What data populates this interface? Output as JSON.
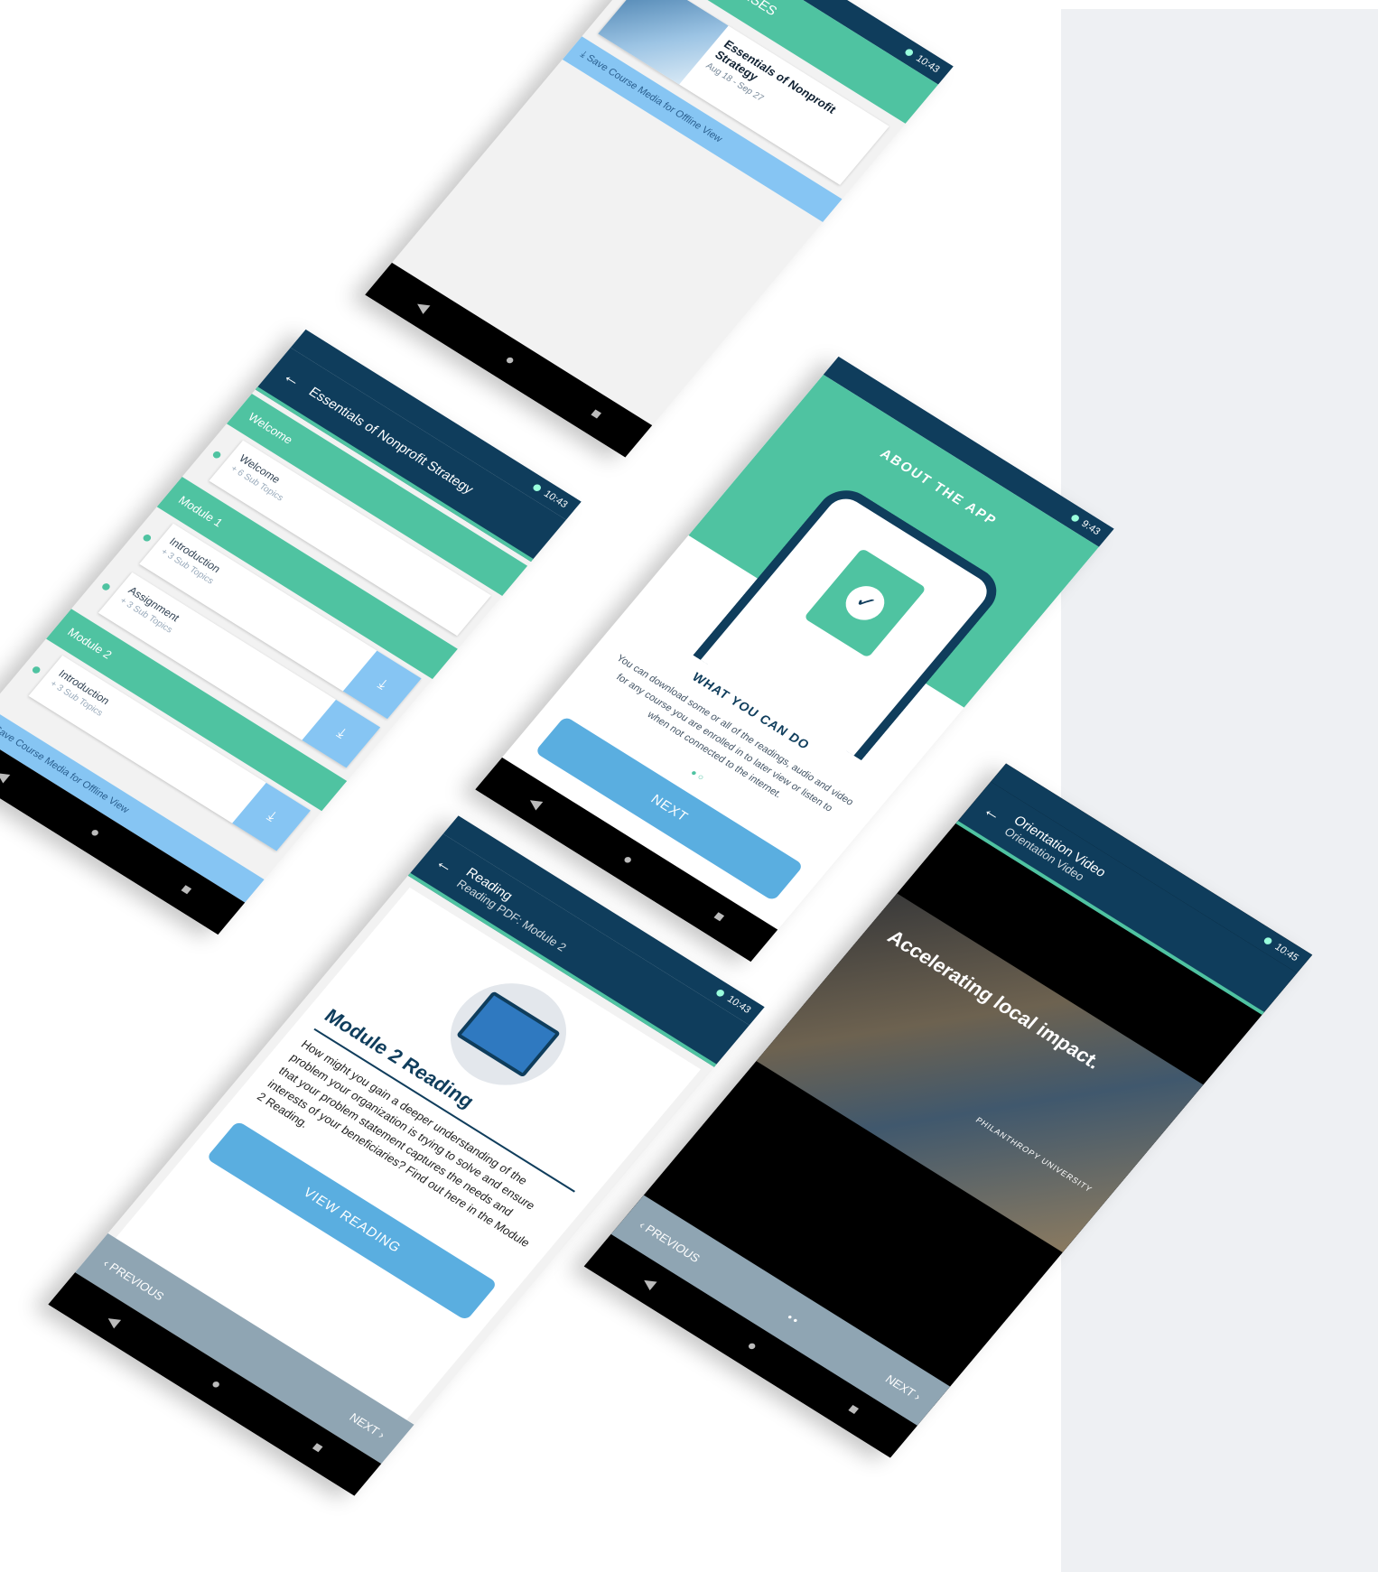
{
  "status": {
    "time_a": "10:43",
    "time_b": "9:43",
    "time_c": "10:45"
  },
  "my_courses": {
    "app_title": "MY COURSES",
    "course_title": "Essentials of Nonprofit Strategy",
    "course_dates": "Aug 18 - Sep 27",
    "save_label": "Save Course Media for Offline View"
  },
  "course_outline": {
    "app_title": "Essentials of Nonprofit Strategy",
    "sections": [
      {
        "name": "Welcome",
        "topics": [
          {
            "name": "Welcome",
            "sub": "+ 6 Sub Topics"
          }
        ]
      },
      {
        "name": "Module 1",
        "topics": [
          {
            "name": "Introduction",
            "sub": "+ 3 Sub Topics"
          },
          {
            "name": "Assignment",
            "sub": "+ 3 Sub Topics"
          }
        ]
      },
      {
        "name": "Module 2",
        "topics": [
          {
            "name": "Introduction",
            "sub": "+ 3 Sub Topics"
          }
        ]
      }
    ],
    "save_label": "Save Course Media for Offline View"
  },
  "about": {
    "heading": "ABOUT THE APP",
    "subheading": "WHAT YOU CAN DO",
    "body": "You can download some or all of the readings, audio and video for any course you are enrolled in to later view or listen to when not connected to the internet.",
    "next_label": "NEXT"
  },
  "reading": {
    "title": "Reading",
    "subtitle": "Reading PDF: Module 2",
    "heading": "Module 2 Reading",
    "body": "How might you gain a deeper understanding of the problem your organization is trying to solve and ensure that your problem statement captures the needs and interests of your beneficiaries? Find out here in the Module 2 Reading.",
    "button_label": "VIEW READING",
    "prev_label": "PREVIOUS",
    "next_label": "NEXT"
  },
  "video": {
    "title": "Orientation Video",
    "subtitle": "Orientation Video",
    "caption": "Accelerating local impact.",
    "logo_text": "PHILANTHROPY UNIVERSITY",
    "prev_label": "PREVIOUS",
    "next_label": "NEXT"
  },
  "icons": {
    "menu": "hamburger-icon",
    "back": "back-arrow-icon",
    "download": "download-icon",
    "check": "check-icon"
  },
  "colors": {
    "navy": "#0f3d5c",
    "teal": "#4fc3a1",
    "light_blue": "#86c5f3",
    "button_blue": "#5aaee0",
    "gray_nav": "#8fa5b3"
  }
}
